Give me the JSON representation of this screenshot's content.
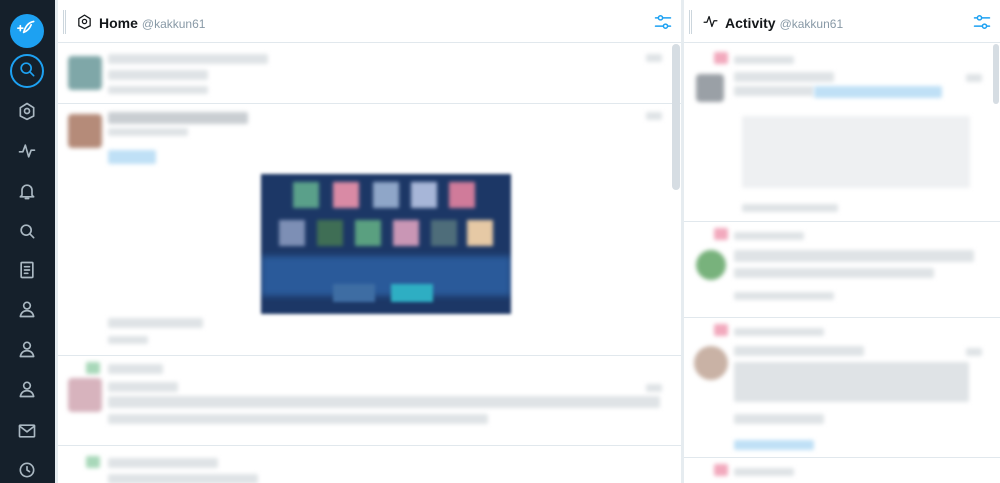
{
  "nav": {
    "items": [
      {
        "name": "compose-button",
        "icon": "compose-icon"
      },
      {
        "name": "search-button",
        "icon": "search-icon"
      },
      {
        "name": "nav-home",
        "icon": "home-icon"
      },
      {
        "name": "nav-activity",
        "icon": "activity-icon"
      },
      {
        "name": "nav-notifications",
        "icon": "bell-icon"
      },
      {
        "name": "nav-search",
        "icon": "search-icon"
      },
      {
        "name": "nav-lists",
        "icon": "list-icon"
      },
      {
        "name": "nav-profile-1",
        "icon": "user-icon"
      },
      {
        "name": "nav-profile-2",
        "icon": "user-icon"
      },
      {
        "name": "nav-profile-3",
        "icon": "user-icon"
      },
      {
        "name": "nav-messages",
        "icon": "mail-icon"
      },
      {
        "name": "nav-scheduled",
        "icon": "clock-icon"
      }
    ]
  },
  "columns": [
    {
      "index": "1",
      "title": "Home",
      "username": "@kakkun61",
      "icon": "home-icon"
    },
    {
      "index": "2",
      "title": "Activity",
      "username": "@kakkun61",
      "icon": "activity-icon"
    }
  ],
  "colors": {
    "accent": "#1da1f2",
    "nav_bg": "#15202b",
    "column_bg": "#ffffff",
    "app_bg": "#e6ecf0"
  }
}
